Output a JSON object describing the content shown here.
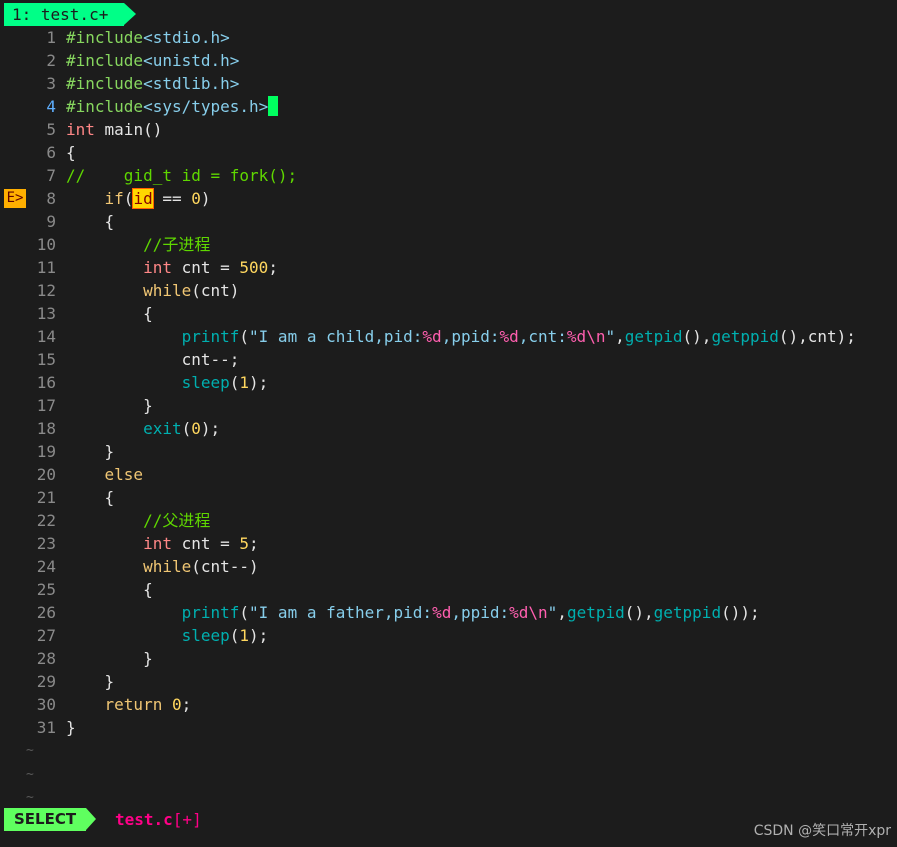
{
  "tab": {
    "label": "1: test.c+"
  },
  "sign": "E>",
  "lines": [
    {
      "n": "1",
      "parts": [
        {
          "c": "pp",
          "t": "#include"
        },
        {
          "c": "str",
          "t": "<stdio.h>"
        }
      ]
    },
    {
      "n": "2",
      "parts": [
        {
          "c": "pp",
          "t": "#include"
        },
        {
          "c": "str",
          "t": "<unistd.h>"
        }
      ]
    },
    {
      "n": "3",
      "parts": [
        {
          "c": "pp",
          "t": "#include"
        },
        {
          "c": "str",
          "t": "<stdlib.h>"
        }
      ]
    },
    {
      "n": "4",
      "cursor": true,
      "parts": [
        {
          "c": "pp",
          "t": "#include"
        },
        {
          "c": "str",
          "t": "<sys/types.h>"
        }
      ]
    },
    {
      "n": "5",
      "parts": [
        {
          "c": "t",
          "t": "int"
        },
        {
          "c": "",
          "t": " main()"
        }
      ]
    },
    {
      "n": "6",
      "parts": [
        {
          "c": "",
          "t": "{"
        }
      ]
    },
    {
      "n": "7",
      "parts": [
        {
          "c": "cm",
          "t": "//    gid_t id = fork();"
        }
      ]
    },
    {
      "n": "8",
      "err": true,
      "parts": [
        {
          "c": "",
          "t": "    "
        },
        {
          "c": "k",
          "t": "if"
        },
        {
          "c": "",
          "t": "("
        },
        {
          "c": "hl",
          "t": "id"
        },
        {
          "c": "",
          "t": " == "
        },
        {
          "c": "num",
          "t": "0"
        },
        {
          "c": "",
          "t": ")"
        }
      ]
    },
    {
      "n": "9",
      "parts": [
        {
          "c": "",
          "t": "    {"
        }
      ]
    },
    {
      "n": "10",
      "parts": [
        {
          "c": "cm",
          "t": "        //子进程"
        }
      ]
    },
    {
      "n": "11",
      "parts": [
        {
          "c": "",
          "t": "        "
        },
        {
          "c": "t",
          "t": "int"
        },
        {
          "c": "",
          "t": " cnt = "
        },
        {
          "c": "num",
          "t": "500"
        },
        {
          "c": "",
          "t": ";"
        }
      ]
    },
    {
      "n": "12",
      "parts": [
        {
          "c": "",
          "t": "        "
        },
        {
          "c": "k",
          "t": "while"
        },
        {
          "c": "",
          "t": "(cnt)"
        }
      ]
    },
    {
      "n": "13",
      "parts": [
        {
          "c": "",
          "t": "        {"
        }
      ]
    },
    {
      "n": "14",
      "parts": [
        {
          "c": "",
          "t": "            "
        },
        {
          "c": "fn",
          "t": "printf"
        },
        {
          "c": "",
          "t": "("
        },
        {
          "c": "str",
          "t": "\"I am a child,pid:"
        },
        {
          "c": "fmt",
          "t": "%d"
        },
        {
          "c": "str",
          "t": ",ppid:"
        },
        {
          "c": "fmt",
          "t": "%d"
        },
        {
          "c": "str",
          "t": ",cnt:"
        },
        {
          "c": "fmt",
          "t": "%d\\n"
        },
        {
          "c": "str",
          "t": "\""
        },
        {
          "c": "",
          "t": ","
        },
        {
          "c": "fn",
          "t": "getpid"
        },
        {
          "c": "",
          "t": "(),"
        },
        {
          "c": "fn",
          "t": "getppid"
        },
        {
          "c": "",
          "t": "(),cnt);"
        }
      ]
    },
    {
      "n": "15",
      "parts": [
        {
          "c": "",
          "t": "            cnt--;"
        }
      ]
    },
    {
      "n": "16",
      "parts": [
        {
          "c": "",
          "t": "            "
        },
        {
          "c": "fn",
          "t": "sleep"
        },
        {
          "c": "",
          "t": "("
        },
        {
          "c": "num",
          "t": "1"
        },
        {
          "c": "",
          "t": ");"
        }
      ]
    },
    {
      "n": "17",
      "parts": [
        {
          "c": "",
          "t": "        }"
        }
      ]
    },
    {
      "n": "18",
      "parts": [
        {
          "c": "",
          "t": "        "
        },
        {
          "c": "fn",
          "t": "exit"
        },
        {
          "c": "",
          "t": "("
        },
        {
          "c": "num",
          "t": "0"
        },
        {
          "c": "",
          "t": ");"
        }
      ]
    },
    {
      "n": "19",
      "parts": [
        {
          "c": "",
          "t": "    }"
        }
      ]
    },
    {
      "n": "20",
      "parts": [
        {
          "c": "",
          "t": "    "
        },
        {
          "c": "k",
          "t": "else"
        }
      ]
    },
    {
      "n": "21",
      "parts": [
        {
          "c": "",
          "t": "    {"
        }
      ]
    },
    {
      "n": "22",
      "parts": [
        {
          "c": "cm",
          "t": "        //父进程"
        }
      ]
    },
    {
      "n": "23",
      "parts": [
        {
          "c": "",
          "t": "        "
        },
        {
          "c": "t",
          "t": "int"
        },
        {
          "c": "",
          "t": " cnt = "
        },
        {
          "c": "num",
          "t": "5"
        },
        {
          "c": "",
          "t": ";"
        }
      ]
    },
    {
      "n": "24",
      "parts": [
        {
          "c": "",
          "t": "        "
        },
        {
          "c": "k",
          "t": "while"
        },
        {
          "c": "",
          "t": "(cnt--)"
        }
      ]
    },
    {
      "n": "25",
      "parts": [
        {
          "c": "",
          "t": "        {"
        }
      ]
    },
    {
      "n": "26",
      "parts": [
        {
          "c": "",
          "t": "            "
        },
        {
          "c": "fn",
          "t": "printf"
        },
        {
          "c": "",
          "t": "("
        },
        {
          "c": "str",
          "t": "\"I am a father,pid:"
        },
        {
          "c": "fmt",
          "t": "%d"
        },
        {
          "c": "str",
          "t": ",ppid:"
        },
        {
          "c": "fmt",
          "t": "%d\\n"
        },
        {
          "c": "str",
          "t": "\""
        },
        {
          "c": "",
          "t": ","
        },
        {
          "c": "fn",
          "t": "getpid"
        },
        {
          "c": "",
          "t": "(),"
        },
        {
          "c": "fn",
          "t": "getppid"
        },
        {
          "c": "",
          "t": "());"
        }
      ]
    },
    {
      "n": "27",
      "parts": [
        {
          "c": "",
          "t": "            "
        },
        {
          "c": "fn",
          "t": "sleep"
        },
        {
          "c": "",
          "t": "("
        },
        {
          "c": "num",
          "t": "1"
        },
        {
          "c": "",
          "t": ");"
        }
      ]
    },
    {
      "n": "28",
      "parts": [
        {
          "c": "",
          "t": "        }"
        }
      ]
    },
    {
      "n": "29",
      "parts": [
        {
          "c": "",
          "t": "    }"
        }
      ]
    },
    {
      "n": "30",
      "parts": [
        {
          "c": "",
          "t": "    "
        },
        {
          "c": "k",
          "t": "return"
        },
        {
          "c": "",
          "t": " "
        },
        {
          "c": "num",
          "t": "0"
        },
        {
          "c": "",
          "t": ";"
        }
      ]
    },
    {
      "n": "31",
      "parts": [
        {
          "c": "",
          "t": "}"
        }
      ]
    }
  ],
  "tildes": [
    "~",
    "~",
    "~"
  ],
  "status": {
    "mode": "SELECT",
    "filename": "test.c",
    "modified": "[+]"
  },
  "watermark": "CSDN @笑口常开xpr"
}
